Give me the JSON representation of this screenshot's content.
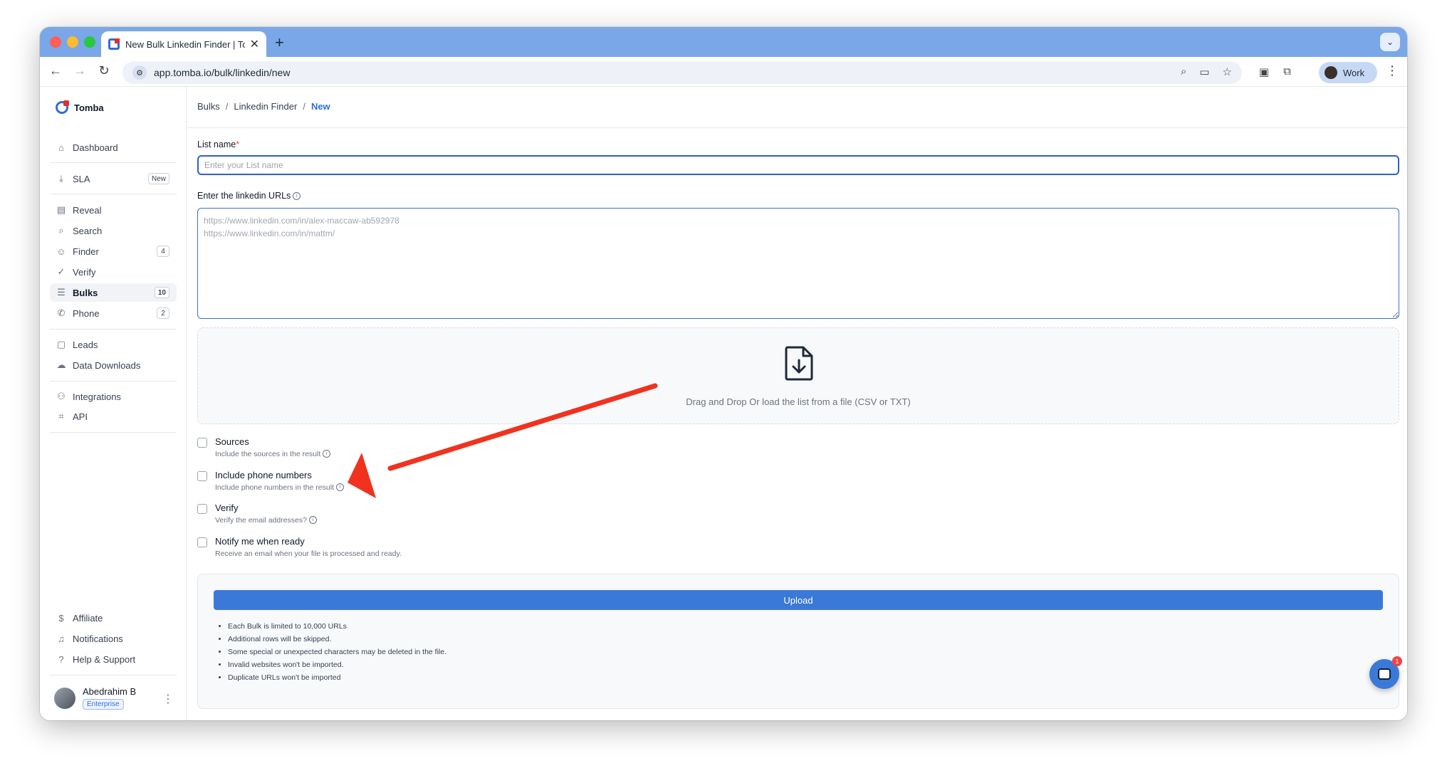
{
  "browser": {
    "tab_title": "New Bulk Linkedin Finder | To",
    "url": "app.tomba.io/bulk/linkedin/new",
    "profile_label": "Work",
    "tab_close_glyph": "✕",
    "new_tab_glyph": "+",
    "menu_glyph": "⌄",
    "kebab_glyph": "⋮"
  },
  "sidebar": {
    "brand": "Tomba",
    "items": [
      {
        "label": "Dashboard",
        "icon": "home-icon"
      },
      {
        "label": "SLA",
        "icon": "download-icon",
        "badge": "New"
      },
      {
        "label": "Reveal",
        "icon": "document-icon"
      },
      {
        "label": "Search",
        "icon": "search-icon"
      },
      {
        "label": "Finder",
        "icon": "user-circle-icon",
        "badge": "4"
      },
      {
        "label": "Verify",
        "icon": "check-circle-icon"
      },
      {
        "label": "Bulks",
        "icon": "list-icon",
        "badge": "10",
        "active": true
      },
      {
        "label": "Phone",
        "icon": "phone-icon",
        "badge": "2"
      },
      {
        "label": "Leads",
        "icon": "lead-file-icon"
      },
      {
        "label": "Data Downloads",
        "icon": "cloud-icon"
      },
      {
        "label": "Integrations",
        "icon": "plug-icon"
      },
      {
        "label": "API",
        "icon": "code-icon"
      }
    ],
    "footer_items": [
      {
        "label": "Affiliate",
        "icon": "dollar-icon"
      },
      {
        "label": "Notifications",
        "icon": "bell-icon"
      },
      {
        "label": "Help & Support",
        "icon": "help-icon"
      }
    ],
    "user": {
      "name": "Abedrahim B",
      "plan": "Enterprise"
    }
  },
  "breadcrumb": {
    "items": [
      "Bulks",
      "Linkedin Finder"
    ],
    "current": "New",
    "separator": "/"
  },
  "form": {
    "list_name_label": "List name",
    "required_mark": "*",
    "list_name_placeholder": "Enter your List name",
    "list_name_value": "",
    "urls_label": "Enter the linkedin URLs",
    "urls_placeholder": "https://www.linkedin.com/in/alex-maccaw-ab592978\nhttps://www.linkedin.com/in/mattm/",
    "dropzone_text": "Drag and Drop Or load the list from a file (CSV or TXT)",
    "options": [
      {
        "title": "Sources",
        "desc": "Include the sources in the result",
        "info": true,
        "checked": false
      },
      {
        "title": "Include phone numbers",
        "desc": "Include phone numbers in the result",
        "info": true,
        "checked": false
      },
      {
        "title": "Verify",
        "desc": "Verify the email addresses?",
        "info": true,
        "checked": false
      },
      {
        "title": "Notify me when ready",
        "desc": "Receive an email when your file is processed and ready.",
        "info": false,
        "checked": false
      }
    ],
    "upload_label": "Upload",
    "notes": [
      "Each Bulk is limited to 10,000 URLs",
      "Additional rows will be skipped.",
      "Some special or unexpected characters may be deleted in the file.",
      "Invalid websites won't be imported.",
      "Duplicate URLs won't be imported"
    ]
  },
  "chat": {
    "badge": "1"
  },
  "colors": {
    "accent": "#3b79d9",
    "brand_red": "#e02d2d",
    "annotation_arrow": "#f0321f"
  }
}
